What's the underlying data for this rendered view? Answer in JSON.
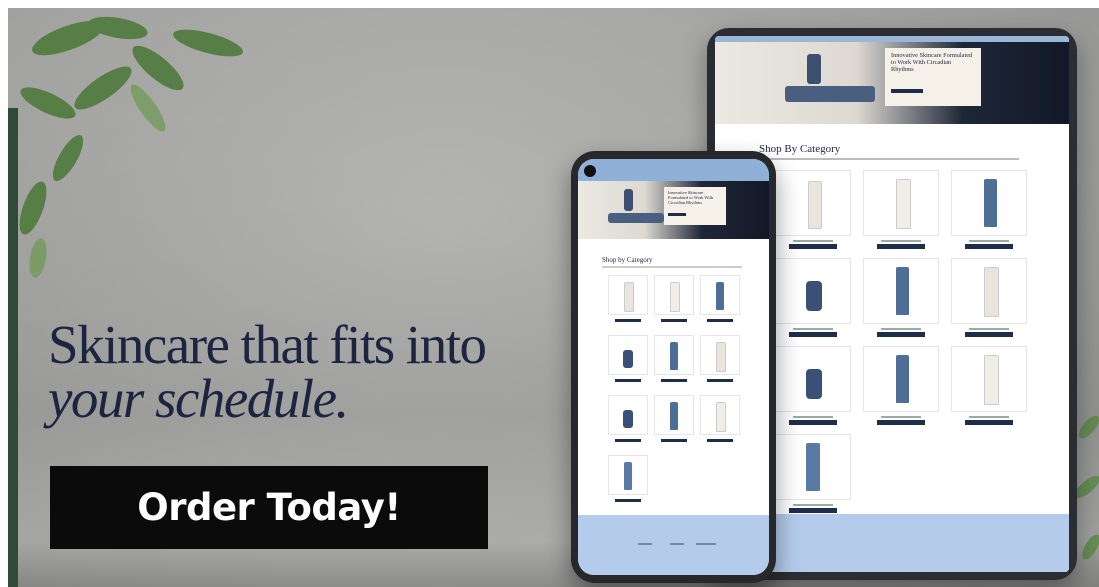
{
  "headline": {
    "line1": "Skincare that fits into",
    "line2": "your schedule."
  },
  "cta": {
    "label": "Order Today!"
  },
  "tablet": {
    "hero_title": "Innovative Skincare Formulated to Work With Circadian Rhythms",
    "section_title": "Shop By Category"
  },
  "phone": {
    "hero_title": "Innovative Skincare Formulated to Work With Circadian Rhythms",
    "section_title": "Shop by Category"
  },
  "colors": {
    "headline": "#1c2440",
    "cta_bg": "#0b0b0b",
    "brand_navy": "#1e2d4a",
    "brand_light_blue": "#b4cbeb"
  },
  "icons": [
    "leaf-foliage-icon",
    "phone-camera-icon"
  ]
}
